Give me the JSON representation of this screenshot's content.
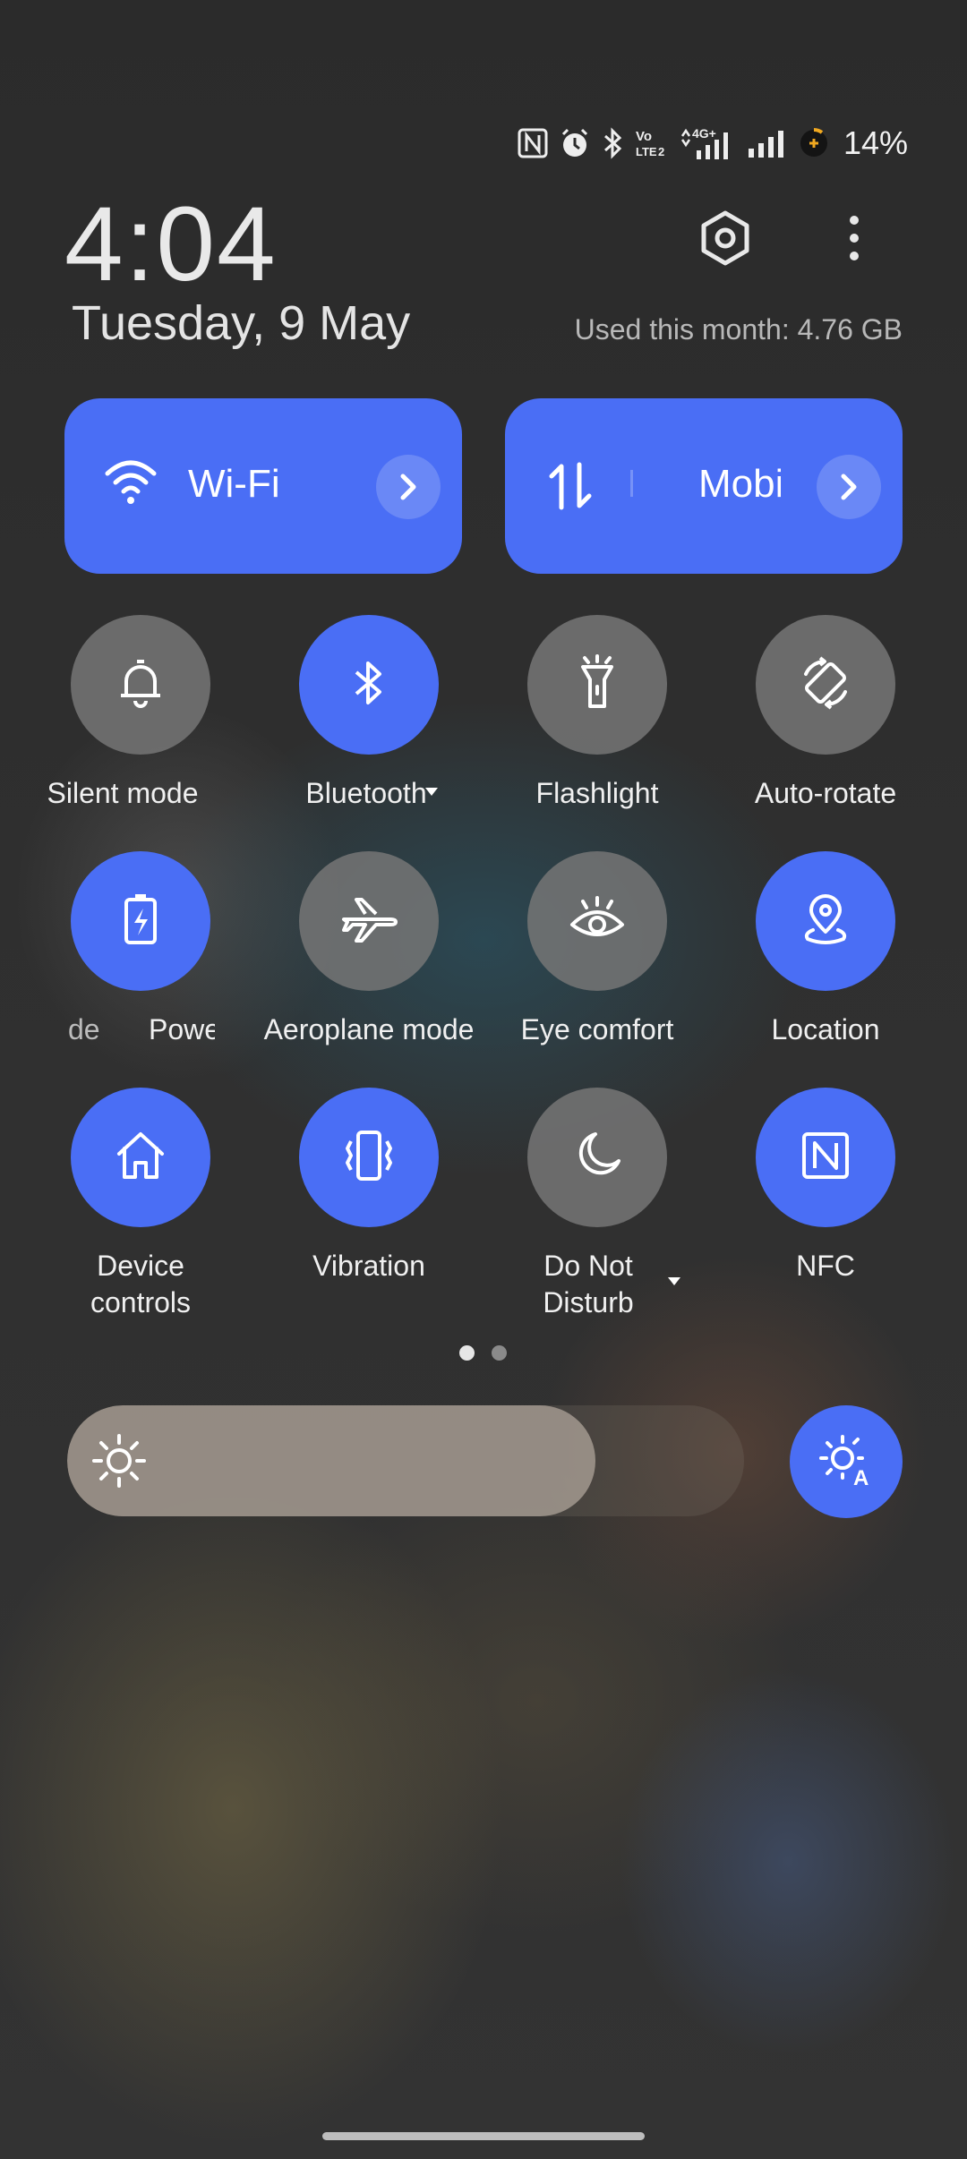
{
  "status_bar": {
    "icons": [
      "nfc-icon",
      "alarm-icon",
      "bluetooth-icon",
      "volte-icon",
      "4g-data-icon",
      "signal-icon",
      "battery-icon"
    ],
    "network_type": "4G+",
    "volte_text": "Vo LTE 2",
    "battery_percent": "14%"
  },
  "header": {
    "time": "4:04",
    "date": "Tuesday, 9 May",
    "data_usage": "Used this month: 4.76 GB"
  },
  "big_tiles": [
    {
      "label": "Wi-Fi",
      "icon": "wifi-icon",
      "state": "on"
    },
    {
      "label": "Mobile",
      "icon": "mobile-data-icon",
      "state": "on"
    }
  ],
  "tiles": [
    {
      "label": "Silent mode",
      "icon": "bell-icon",
      "state": "off"
    },
    {
      "label": "Bluetooth",
      "icon": "bluetooth-icon",
      "state": "on"
    },
    {
      "label": "Flashlight",
      "icon": "flashlight-icon",
      "state": "off"
    },
    {
      "label": "Auto-rotate",
      "icon": "auto-rotate-icon",
      "state": "off"
    },
    {
      "label": "de",
      "label2": "Powe",
      "icon": "battery-saver-icon",
      "state": "on"
    },
    {
      "label": "Aeroplane mode",
      "icon": "airplane-icon",
      "state": "off"
    },
    {
      "label": "Eye comfort",
      "icon": "eye-icon",
      "state": "off"
    },
    {
      "label": "Location",
      "icon": "location-icon",
      "state": "on"
    },
    {
      "label": "Device controls",
      "icon": "home-icon",
      "state": "on"
    },
    {
      "label": "Vibration",
      "icon": "vibration-icon",
      "state": "on"
    },
    {
      "label": "Do Not Disturb",
      "icon": "moon-icon",
      "state": "off"
    },
    {
      "label": "NFC",
      "icon": "nfc-icon",
      "state": "on"
    }
  ],
  "pager": {
    "current": 1,
    "total": 2
  },
  "brightness": {
    "level": 0.78,
    "auto": true
  },
  "colors": {
    "accent": "#4a6ef5",
    "tile_off": "#767676",
    "background": "#2d2d2d"
  }
}
